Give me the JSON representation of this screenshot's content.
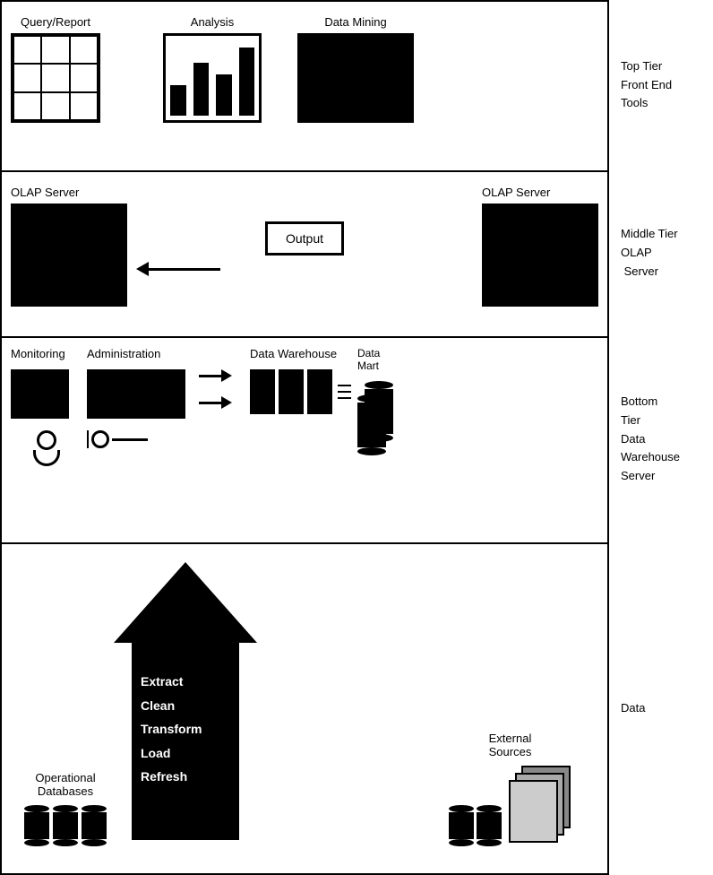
{
  "tiers": {
    "top": {
      "label": "Top Tier\nFront End Tools",
      "tools": [
        {
          "name": "Query/Report",
          "type": "grid"
        },
        {
          "name": "Analysis",
          "type": "barchart"
        },
        {
          "name": "Data Mining",
          "type": "blackbox"
        }
      ]
    },
    "middle": {
      "label": "Middle Tier\nOLAP\n Server",
      "olap_left": "OLAP Server",
      "output": "Output",
      "olap_right": "OLAP Server"
    },
    "bottom": {
      "label": "Bottom\nTier\nData\nWarehouse\nServer",
      "monitoring": "Monitoring",
      "administration": "Administration",
      "dataWarehouse": "Data Warehouse",
      "dataMart": "Data\nMart"
    },
    "data": {
      "label": "Data",
      "arrow_text": "Extract\nClean\nTransform\nLoad\nRefresh",
      "operational": "Operational\nDatabases",
      "external": "External\nSources"
    }
  }
}
